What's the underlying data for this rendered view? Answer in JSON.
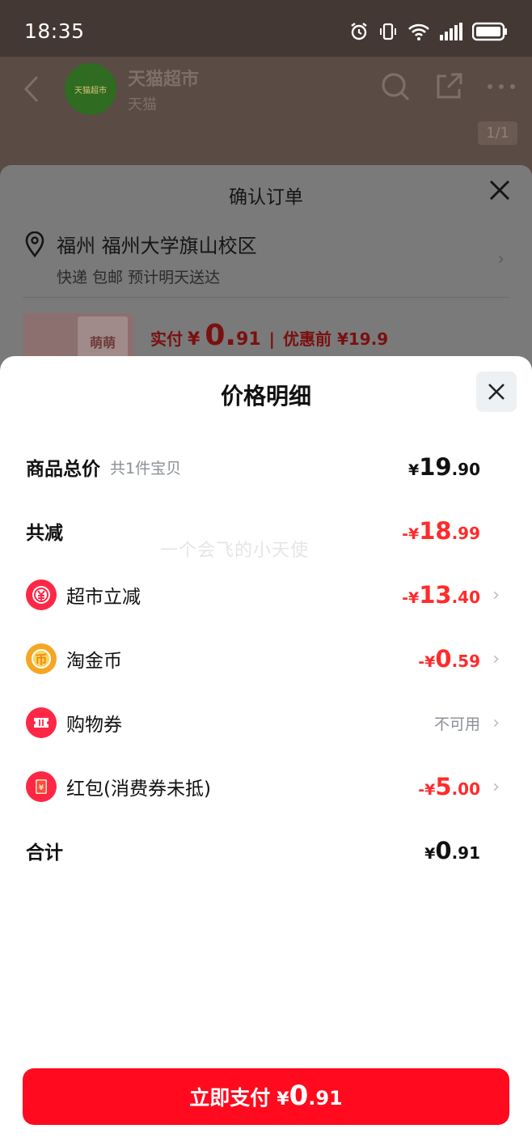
{
  "status_bar": {
    "time": "18:35"
  },
  "store": {
    "name": "天猫超市",
    "sub": "天猫",
    "logo_text": "天猫超市",
    "pager": "1/1"
  },
  "confirm_order": {
    "title": "确认订单",
    "address": "福州 福州大学旗山校区",
    "shipping": "快递 包邮 预计明天送达",
    "pay_label": "实付",
    "pay_currency": "¥",
    "pay_int": "0.",
    "pay_dec": "91",
    "before_label": "优惠前 ¥19.9",
    "product_text": "萌萌"
  },
  "price_detail": {
    "title": "价格明细",
    "watermark": "一个会飞的小天使",
    "rows": [
      {
        "label": "商品总价",
        "sub": "共1件宝贝",
        "currency": "¥",
        "int": "19",
        "dec": ".90"
      },
      {
        "label": "共减",
        "currency": "-¥",
        "int": "18",
        "dec": ".99"
      },
      {
        "label": "超市立减",
        "icon": "discount-icon",
        "currency": "-¥",
        "int": "13",
        "dec": ".40"
      },
      {
        "label": "淘金币",
        "icon": "coin-icon",
        "currency": "-¥",
        "int": "0",
        "dec": ".59"
      },
      {
        "label": "购物券",
        "icon": "ticket-icon",
        "status": "不可用"
      },
      {
        "label": "红包(消费券未抵)",
        "icon": "red-envelope-icon",
        "currency": "-¥",
        "int": "5",
        "dec": ".00"
      },
      {
        "label": "合计",
        "currency": "¥",
        "int": "0",
        "dec": ".91"
      }
    ]
  },
  "pay_button": {
    "label": "立即支付",
    "currency": "¥",
    "int": "0",
    "dec": ".91"
  },
  "colors": {
    "accent_red": "#ff0a1e",
    "discount_red": "#ff2b2b",
    "coin_orange": "#f5a623"
  }
}
